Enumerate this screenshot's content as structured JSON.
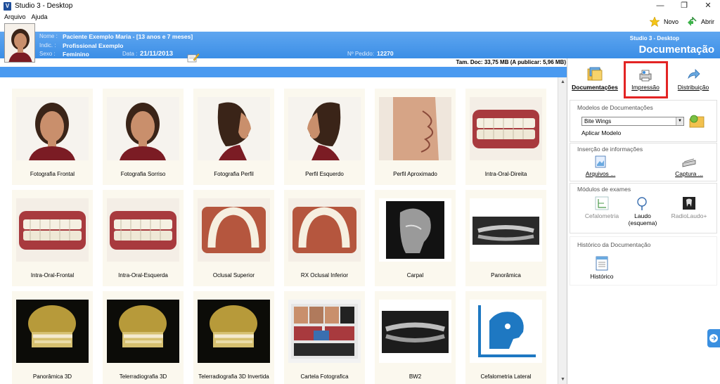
{
  "window": {
    "title": "Studio 3 - Desktop",
    "app_icon_letter": "V"
  },
  "menu": [
    "Arquivo",
    "Ajuda"
  ],
  "toolbar": {
    "novo": "Novo",
    "abrir": "Abrir"
  },
  "patient": {
    "nome_label": "Nome :",
    "nome": "Paciente Exemplo Maria - [13 anos e 7 meses]",
    "indic_label": "Indic. :",
    "indic": "Profissional Exemplo",
    "sexo_label": "Sexo :",
    "sexo": "Feminino",
    "data_label": "Data :",
    "data": "21/11/2013",
    "pedido_label": "Nº Pedido:",
    "pedido": "12270"
  },
  "header": {
    "studio": "Studio 3 - Desktop",
    "section": "Documentação"
  },
  "taminfo": "Tam. Doc: 33,75 MB (A publicar: 5,96 MB)",
  "grid": [
    {
      "caption": "Fotografia Frontal",
      "kind": "face-front"
    },
    {
      "caption": "Fotografia Sorriso",
      "kind": "face-front"
    },
    {
      "caption": "Fotografia Perfil",
      "kind": "face-side"
    },
    {
      "caption": "Perfil Esquerdo",
      "kind": "face-side-left"
    },
    {
      "caption": "Perfil Aproximado",
      "kind": "lips"
    },
    {
      "caption": "Intra-Oral-Direita",
      "kind": "teeth"
    },
    {
      "caption": "Intra-Oral-Frontal",
      "kind": "teeth"
    },
    {
      "caption": "Intra-Oral-Esquerda",
      "kind": "teeth"
    },
    {
      "caption": "Oclusal Superior",
      "kind": "arch"
    },
    {
      "caption": "RX Oclusal Inferior",
      "kind": "arch"
    },
    {
      "caption": "Carpal",
      "kind": "xray-skull"
    },
    {
      "caption": "Panorâmica",
      "kind": "pano"
    },
    {
      "caption": "Panorâmica 3D",
      "kind": "skull3d"
    },
    {
      "caption": "Telerradiografia 3D",
      "kind": "skull3d"
    },
    {
      "caption": "Telerradiografia 3D Invertida",
      "kind": "skull3d"
    },
    {
      "caption": "Cartela Fotografica",
      "kind": "collage"
    },
    {
      "caption": "BW2",
      "kind": "pano-dark"
    },
    {
      "caption": "Cefalometria Lateral",
      "kind": "ceph-icon"
    }
  ],
  "rpanel": {
    "tabs": [
      "Documentações",
      "Impressão",
      "Distribuição"
    ],
    "modelos_title": "Modelos de Documentações",
    "modelo_selected": "Bite Wings",
    "aplicar": "Aplicar Modelo",
    "insercao_title": "Inserção de informações",
    "arquivos": "Arquivos ...",
    "captura": "Captura ...",
    "modulos_title": "Módulos de exames",
    "cefalometria": "Cefalometria",
    "laudo": "Laudo (esquema)",
    "radiolaudo": "RadioLaudo+",
    "historico_title": "Histórico da Documentação",
    "historico": "Histórico"
  }
}
